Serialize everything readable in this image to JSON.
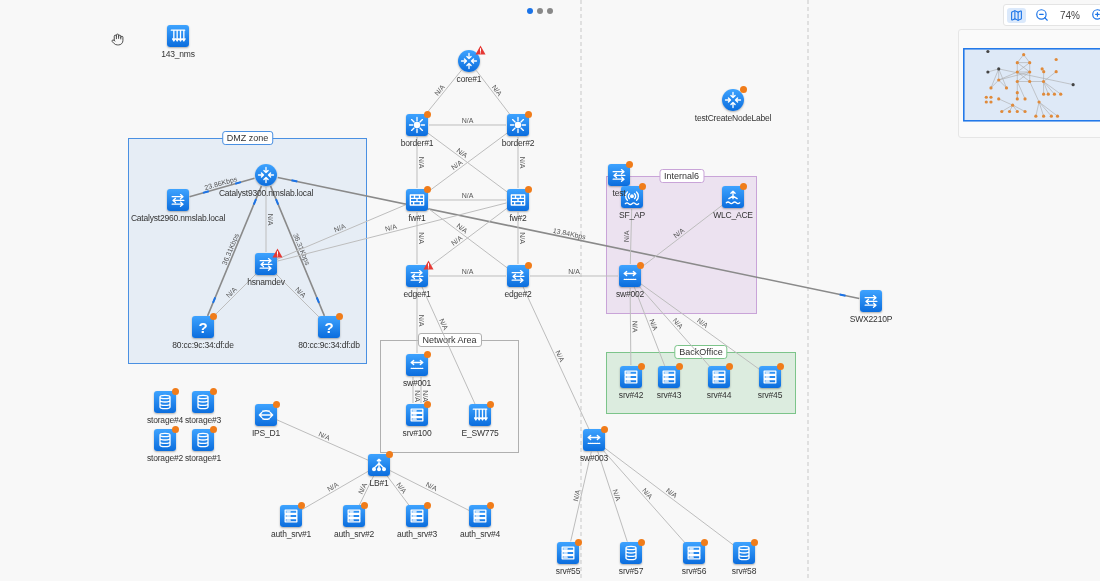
{
  "pages": [
    {
      "selected": true
    },
    {
      "selected": false
    },
    {
      "selected": false
    }
  ],
  "toolbar": {
    "minimap_toggle": {
      "selected": true
    },
    "zoom": "74%"
  },
  "zones": [
    {
      "label": "DMZ zone",
      "color": "#4a90e2"
    },
    {
      "label": "Internal6",
      "color": "#c9a4d8"
    },
    {
      "label": "Network Area",
      "color": "#b0b0b0"
    },
    {
      "label": "BackOffice",
      "color": "#7cc48a"
    }
  ],
  "nodes": [
    {
      "label": "143_nms",
      "kind": "patch",
      "alert": false,
      "status_dot": false
    },
    {
      "label": "core#1",
      "kind": "router",
      "alert": true,
      "status_dot": false
    },
    {
      "label": "border#1",
      "kind": "star",
      "alert": false,
      "status_dot": true
    },
    {
      "label": "border#2",
      "kind": "star",
      "alert": false,
      "status_dot": true
    },
    {
      "label": "Catalyst9300.nmslab.local",
      "kind": "router",
      "alert": false,
      "status_dot": false
    },
    {
      "label": "Catalyst2960.nmslab.local",
      "kind": "switch",
      "alert": false,
      "status_dot": false
    },
    {
      "label": "fw#1",
      "kind": "firewall",
      "alert": false,
      "status_dot": true
    },
    {
      "label": "fw#2",
      "kind": "firewall",
      "alert": false,
      "status_dot": true
    },
    {
      "label": "hsnamdev",
      "kind": "switch",
      "alert": true,
      "status_dot": false
    },
    {
      "label": "edge#1",
      "kind": "switch",
      "alert": true,
      "status_dot": false
    },
    {
      "label": "edge#2",
      "kind": "switch",
      "alert": false,
      "status_dot": true
    },
    {
      "label": "sw#002",
      "kind": "l2switch",
      "alert": false,
      "status_dot": true
    },
    {
      "label": "80:cc:9c:34:df:de",
      "kind": "unknown",
      "glyph": "?",
      "alert": false,
      "status_dot": true
    },
    {
      "label": "80:cc:9c:34:df:db",
      "kind": "unknown",
      "glyph": "?",
      "alert": false,
      "status_dot": true
    },
    {
      "label": "SWX2210P",
      "kind": "switch",
      "alert": false,
      "status_dot": false
    },
    {
      "label": "testCreateNodeLabel",
      "kind": "router",
      "alert": false,
      "status_dot": true
    },
    {
      "label": "test",
      "kind": "switch",
      "alert": false,
      "status_dot": true
    },
    {
      "label": "SF_AP",
      "kind": "ap",
      "alert": false,
      "status_dot": true
    },
    {
      "label": "WLC_ACE",
      "kind": "wlc",
      "alert": false,
      "status_dot": true
    },
    {
      "label": "sw#001",
      "kind": "l2switch",
      "alert": false,
      "status_dot": true
    },
    {
      "label": "srv#100",
      "kind": "server",
      "alert": false,
      "status_dot": true
    },
    {
      "label": "E_SW775",
      "kind": "patch",
      "alert": false,
      "status_dot": true
    },
    {
      "label": "srv#42",
      "kind": "server",
      "alert": false,
      "status_dot": true
    },
    {
      "label": "srv#43",
      "kind": "server",
      "alert": false,
      "status_dot": true
    },
    {
      "label": "srv#44",
      "kind": "server",
      "alert": false,
      "status_dot": true
    },
    {
      "label": "srv#45",
      "kind": "server",
      "alert": false,
      "status_dot": true
    },
    {
      "label": "storage#4",
      "kind": "storage",
      "alert": false,
      "status_dot": true
    },
    {
      "label": "storage#3",
      "kind": "storage",
      "alert": false,
      "status_dot": true
    },
    {
      "label": "storage#2",
      "kind": "storage",
      "alert": false,
      "status_dot": true
    },
    {
      "label": "storage#1",
      "kind": "storage",
      "alert": false,
      "status_dot": true
    },
    {
      "label": "IPS_D1",
      "kind": "ips",
      "alert": false,
      "status_dot": true
    },
    {
      "label": "sw#003",
      "kind": "l2switch",
      "alert": false,
      "status_dot": true
    },
    {
      "label": "LB#1",
      "kind": "lb",
      "alert": false,
      "status_dot": true
    },
    {
      "label": "auth_srv#1",
      "kind": "server",
      "alert": false,
      "status_dot": true
    },
    {
      "label": "auth_srv#2",
      "kind": "server",
      "alert": false,
      "status_dot": true
    },
    {
      "label": "auth_srv#3",
      "kind": "server",
      "alert": false,
      "status_dot": true
    },
    {
      "label": "auth_srv#4",
      "kind": "server",
      "alert": false,
      "status_dot": true
    },
    {
      "label": "srv#55",
      "kind": "server",
      "alert": false,
      "status_dot": true
    },
    {
      "label": "srv#57",
      "kind": "storage",
      "alert": false,
      "status_dot": true
    },
    {
      "label": "srv#56",
      "kind": "server",
      "alert": false,
      "status_dot": true
    },
    {
      "label": "srv#58",
      "kind": "storage",
      "alert": false,
      "status_dot": true
    }
  ],
  "links": [
    {
      "label": "N/A",
      "kind": "plain"
    },
    {
      "label": "N/A",
      "kind": "plain"
    },
    {
      "label": "N/A",
      "kind": "plain"
    },
    {
      "label": "N/A",
      "kind": "plain"
    },
    {
      "label": "N/A",
      "kind": "plain"
    },
    {
      "label": "N/A",
      "kind": "plain"
    },
    {
      "label": "N/A",
      "kind": "plain"
    },
    {
      "label": "N/A",
      "kind": "plain"
    },
    {
      "label": "23.86Kbps",
      "kind": "traffic"
    },
    {
      "label": "13.84Kbps",
      "kind": "traffic"
    },
    {
      "label": "N/A",
      "kind": "plain"
    },
    {
      "label": "36.31Kbps",
      "kind": "traffic"
    },
    {
      "label": "36.31Kbps",
      "kind": "traffic"
    },
    {
      "label": "N/A",
      "kind": "plain"
    },
    {
      "label": "N/A",
      "kind": "plain"
    },
    {
      "label": "N/A",
      "kind": "plain"
    },
    {
      "label": "N/A",
      "kind": "plain"
    },
    {
      "label": "N/A",
      "kind": "plain"
    },
    {
      "label": "N/A",
      "kind": "plain"
    },
    {
      "label": "N/A",
      "kind": "plain"
    },
    {
      "label": "N/A",
      "kind": "plain"
    },
    {
      "label": "N/A",
      "kind": "plain"
    },
    {
      "label": "N/A",
      "kind": "plain"
    },
    {
      "label": "N/A",
      "kind": "plain"
    },
    {
      "label": "N/A",
      "kind": "plain"
    },
    {
      "label": "N/A",
      "kind": "plain"
    },
    {
      "label": "N/A",
      "kind": "plain"
    },
    {
      "label": "N/A",
      "kind": "plain"
    },
    {
      "label": "N/A",
      "kind": "plain"
    },
    {
      "label": "N/A",
      "kind": "plain"
    },
    {
      "label": "N/A",
      "kind": "plain"
    },
    {
      "label": "N/A",
      "kind": "plain"
    },
    {
      "label": "N/A",
      "kind": "plain"
    },
    {
      "label": "N/A",
      "kind": "plain"
    },
    {
      "label": "N/A",
      "kind": "plain"
    },
    {
      "label": "N/A",
      "kind": "plain"
    },
    {
      "label": "N/A",
      "kind": "plain"
    },
    {
      "label": "N/A",
      "kind": "plain"
    },
    {
      "label": "N/A",
      "kind": "plain"
    },
    {
      "label": "N/A",
      "kind": "plain"
    },
    {
      "label": "N/A",
      "kind": "plain"
    },
    {
      "label": "N/A",
      "kind": "plain"
    },
    {
      "label": "N/A",
      "kind": "plain"
    }
  ]
}
